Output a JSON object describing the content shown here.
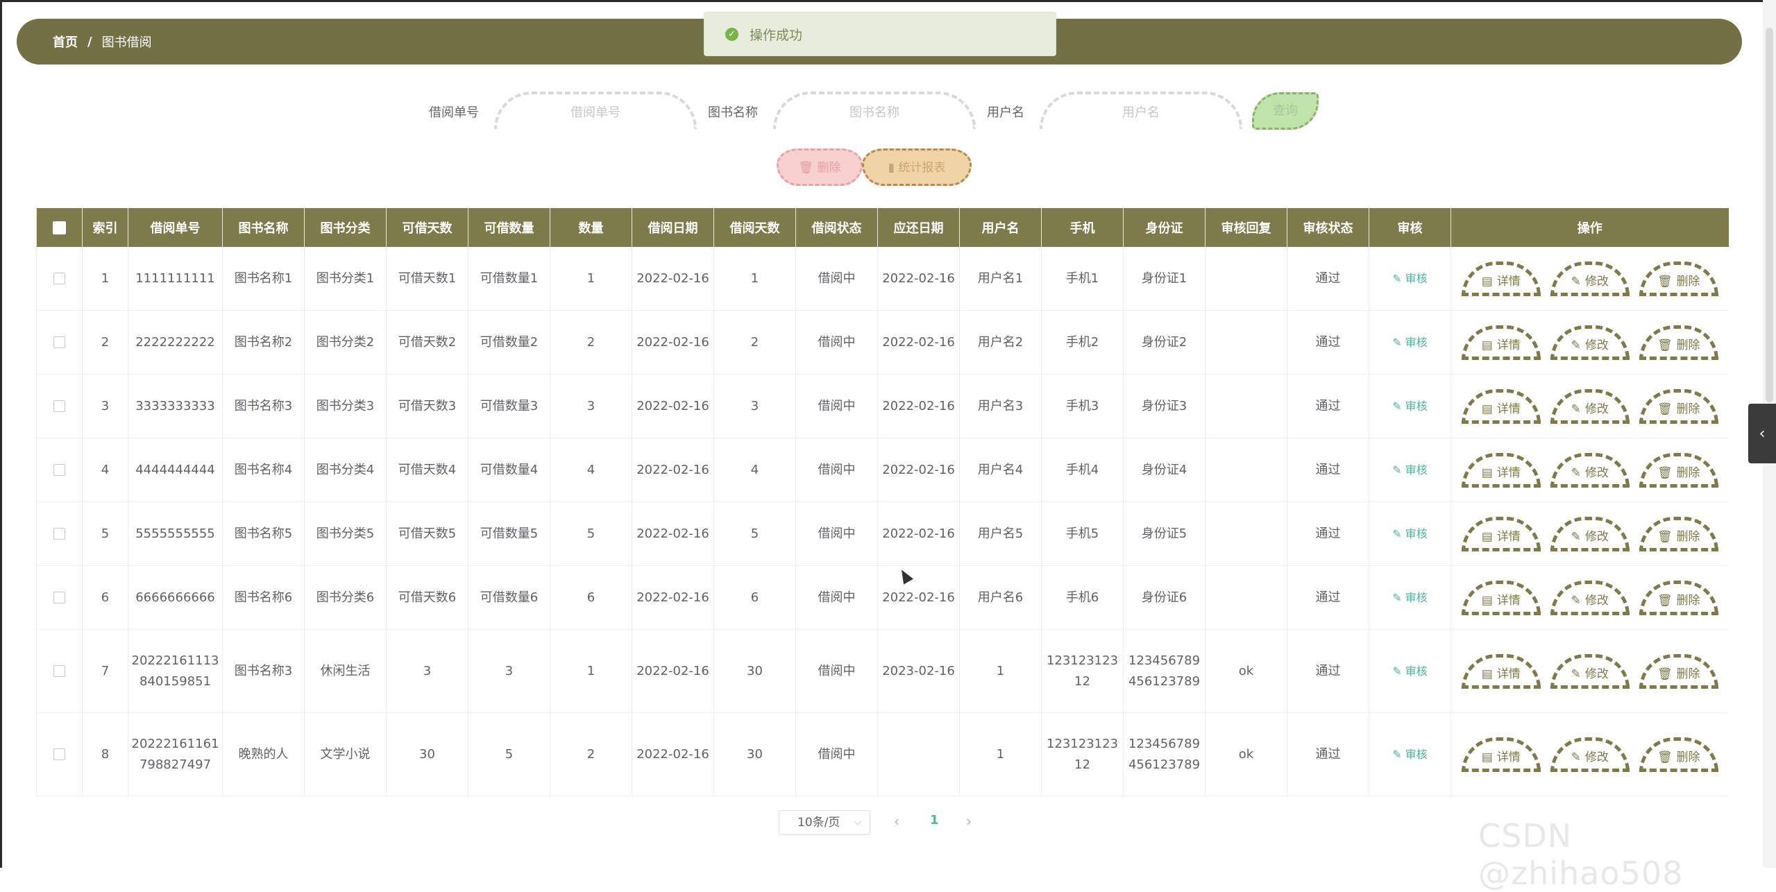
{
  "breadcrumb": {
    "home": "首页",
    "separator": "/",
    "current": "图书借阅"
  },
  "toast": {
    "message": "操作成功"
  },
  "search": {
    "borrow_no_label": "借阅单号",
    "borrow_no_placeholder": "借阅单号",
    "book_name_label": "图书名称",
    "book_name_placeholder": "图书名称",
    "username_label": "用户名",
    "username_placeholder": "用户名",
    "query_button": "查询"
  },
  "actions": {
    "delete_button": "删除",
    "report_button": "统计报表"
  },
  "table": {
    "headers": [
      "索引",
      "借阅单号",
      "图书名称",
      "图书分类",
      "可借天数",
      "可借数量",
      "数量",
      "借阅日期",
      "借阅天数",
      "借阅状态",
      "应还日期",
      "用户名",
      "手机",
      "身份证",
      "审核回复",
      "审核状态",
      "审核",
      "操作"
    ],
    "audit_link": "审核",
    "op_labels": {
      "detail": "详情",
      "edit": "修改",
      "delete": "删除"
    },
    "rows": [
      {
        "index": "1",
        "borrow_no": "1111111111",
        "book": "图书名称1",
        "category": "图书分类1",
        "avail_days": "可借天数1",
        "avail_qty": "可借数量1",
        "qty": "1",
        "borrow_date": "2022-02-16",
        "days": "1",
        "status": "借阅中",
        "due_date": "2022-02-16",
        "user": "用户名1",
        "phone": "手机1",
        "id_card": "身份证1",
        "reply": "",
        "audit_status": "通过"
      },
      {
        "index": "2",
        "borrow_no": "2222222222",
        "book": "图书名称2",
        "category": "图书分类2",
        "avail_days": "可借天数2",
        "avail_qty": "可借数量2",
        "qty": "2",
        "borrow_date": "2022-02-16",
        "days": "2",
        "status": "借阅中",
        "due_date": "2022-02-16",
        "user": "用户名2",
        "phone": "手机2",
        "id_card": "身份证2",
        "reply": "",
        "audit_status": "通过"
      },
      {
        "index": "3",
        "borrow_no": "3333333333",
        "book": "图书名称3",
        "category": "图书分类3",
        "avail_days": "可借天数3",
        "avail_qty": "可借数量3",
        "qty": "3",
        "borrow_date": "2022-02-16",
        "days": "3",
        "status": "借阅中",
        "due_date": "2022-02-16",
        "user": "用户名3",
        "phone": "手机3",
        "id_card": "身份证3",
        "reply": "",
        "audit_status": "通过"
      },
      {
        "index": "4",
        "borrow_no": "4444444444",
        "book": "图书名称4",
        "category": "图书分类4",
        "avail_days": "可借天数4",
        "avail_qty": "可借数量4",
        "qty": "4",
        "borrow_date": "2022-02-16",
        "days": "4",
        "status": "借阅中",
        "due_date": "2022-02-16",
        "user": "用户名4",
        "phone": "手机4",
        "id_card": "身份证4",
        "reply": "",
        "audit_status": "通过"
      },
      {
        "index": "5",
        "borrow_no": "5555555555",
        "book": "图书名称5",
        "category": "图书分类5",
        "avail_days": "可借天数5",
        "avail_qty": "可借数量5",
        "qty": "5",
        "borrow_date": "2022-02-16",
        "days": "5",
        "status": "借阅中",
        "due_date": "2022-02-16",
        "user": "用户名5",
        "phone": "手机5",
        "id_card": "身份证5",
        "reply": "",
        "audit_status": "通过"
      },
      {
        "index": "6",
        "borrow_no": "6666666666",
        "book": "图书名称6",
        "category": "图书分类6",
        "avail_days": "可借天数6",
        "avail_qty": "可借数量6",
        "qty": "6",
        "borrow_date": "2022-02-16",
        "days": "6",
        "status": "借阅中",
        "due_date": "2022-02-16",
        "user": "用户名6",
        "phone": "手机6",
        "id_card": "身份证6",
        "reply": "",
        "audit_status": "通过"
      },
      {
        "index": "7",
        "borrow_no": "20222161113840159851",
        "book": "图书名称3",
        "category": "休闲生活",
        "avail_days": "3",
        "avail_qty": "3",
        "qty": "1",
        "borrow_date": "2022-02-16",
        "days": "30",
        "status": "借阅中",
        "due_date": "2023-02-16",
        "user": "1",
        "phone": "12312312312",
        "id_card": "123456789456123789",
        "reply": "ok",
        "audit_status": "通过"
      },
      {
        "index": "8",
        "borrow_no": "20222161161798827497",
        "book": "晚熟的人",
        "category": "文学小说",
        "avail_days": "30",
        "avail_qty": "5",
        "qty": "2",
        "borrow_date": "2022-02-16",
        "days": "30",
        "status": "借阅中",
        "due_date": "",
        "user": "1",
        "phone": "12312312312",
        "id_card": "123456789456123789",
        "reply": "ok",
        "audit_status": "通过"
      }
    ]
  },
  "pagination": {
    "page_size": "10条/页",
    "current_page": "1"
  },
  "watermark": "CSDN @zhihao508"
}
